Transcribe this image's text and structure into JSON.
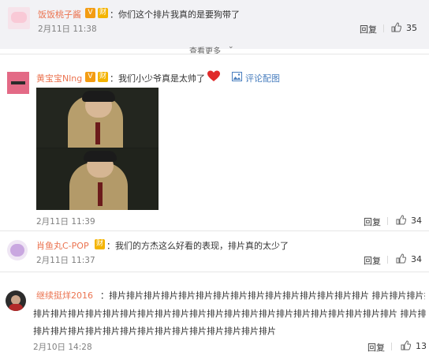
{
  "comments": [
    {
      "name": "饭饭桃子酱",
      "badges": [
        "V",
        "财"
      ],
      "text": "：你们这个排片我真的是要狗带了",
      "timestamp": "2月11日 11:38",
      "reply_label": "回复",
      "likes": "35"
    },
    {
      "name": "黄宝宝Nlng",
      "badges": [
        "V",
        "财"
      ],
      "text": "：我们小少爷真是太帅了",
      "comment_photo_label": "评论配图",
      "timestamp": "2月11日 11:39",
      "reply_label": "回复",
      "likes": "34"
    },
    {
      "name": "肖鱼丸C-POP",
      "badges": [
        "财"
      ],
      "text": "：我们的方杰这么好看的表现，排片真的太少了",
      "timestamp": "2月11日 11:37",
      "reply_label": "回复",
      "likes": "34"
    },
    {
      "name": "继续挺烊2016",
      "text_lines": [
        "：排片排片排片排片排片排片排片排片排片排片排片排片排片排片排片 排片排片排片排片排片",
        "排片排片排片排片排片排片排片排片排片排片排片排片排片排片排片排片排片排片排片排片排片 排片排片排片排片",
        "排片排片排片排片排片排片排片排片排片排片排片排片排片排片"
      ],
      "timestamp": "2月10日 14:28",
      "reply_label": "回复",
      "likes": "13"
    }
  ],
  "view_more_label": "查看更多",
  "colors": {
    "name": "#eb7350",
    "divider": "#e6e6e6",
    "band": "#f2f2f5"
  }
}
